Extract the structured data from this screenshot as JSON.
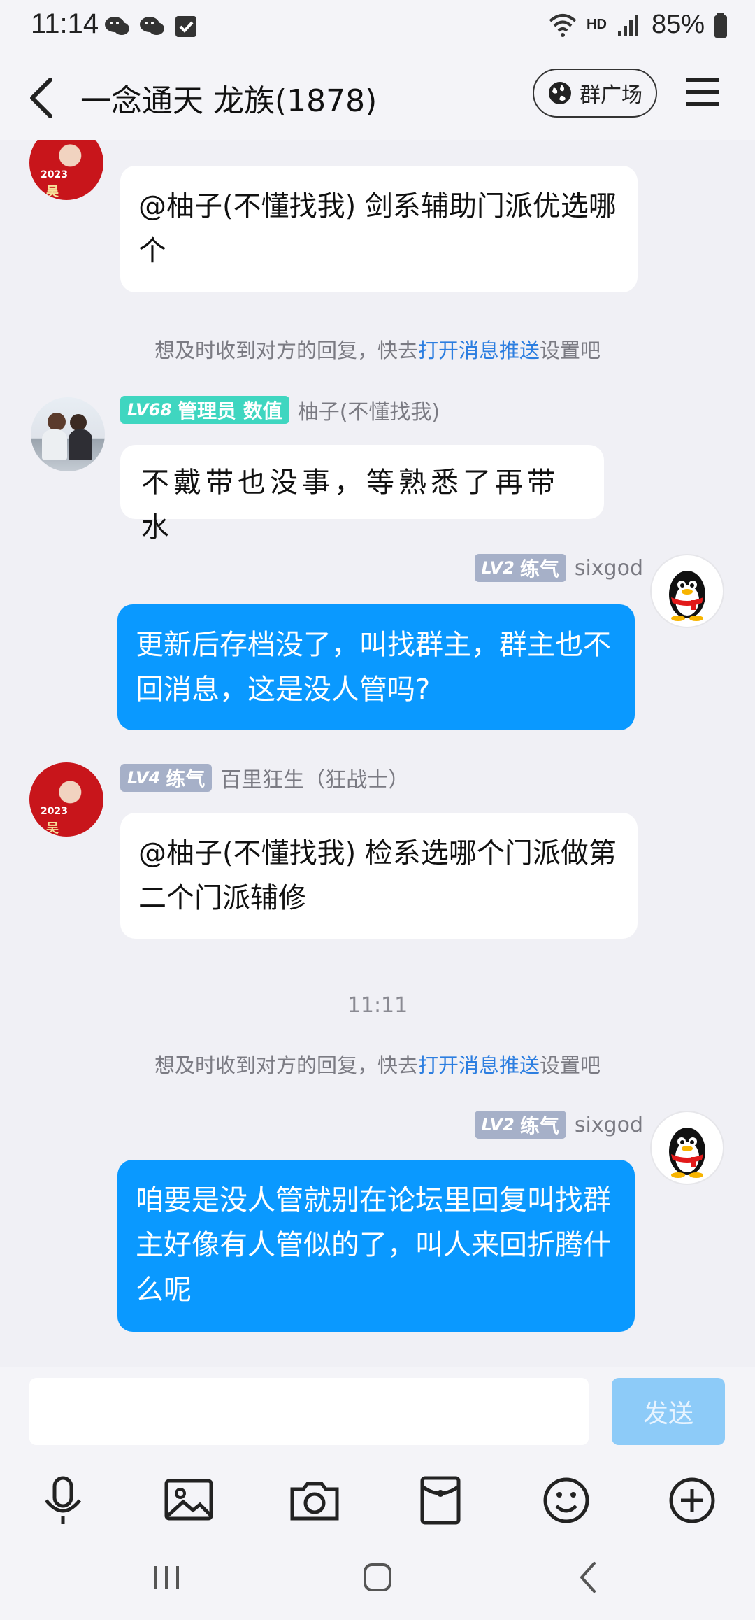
{
  "status_bar": {
    "time": "11:14",
    "battery": "85%",
    "network_label": "HD"
  },
  "header": {
    "title": "一念通天 龙族(1878)",
    "square_button": "群广场"
  },
  "messages": [
    {
      "side": "left",
      "avatar": "avatar-red-2023",
      "text": "@柚子(不懂找我) 剑系辅助门派优选哪个"
    },
    {
      "notice": {
        "prefix": "想及时收到对方的回复，快去",
        "link": "打开消息推送",
        "suffix": "设置吧"
      }
    },
    {
      "side": "left",
      "avatar": "avatar-couple",
      "badge_level": "LV68",
      "badge_title": "管理员 数值",
      "name": "柚子(不懂找我)",
      "text": "不戴带也没事，等熟悉了再带水"
    },
    {
      "side": "right",
      "avatar": "qq-penguin-icon",
      "badge_level": "LV2",
      "badge_title": "练气",
      "name": "sixgod",
      "text": "更新后存档没了，叫找群主，群主也不回消息，这是没人管吗?"
    },
    {
      "side": "left",
      "avatar": "avatar-red-2023",
      "badge_level": "LV4",
      "badge_title": "练气",
      "name": "百里狂生（狂战士）",
      "text": "@柚子(不懂找我) 检系选哪个门派做第二个门派辅修"
    },
    {
      "time": "11:11"
    },
    {
      "notice": {
        "prefix": "想及时收到对方的回复，快去",
        "link": "打开消息推送",
        "suffix": "设置吧"
      }
    },
    {
      "side": "right",
      "avatar": "qq-penguin-icon",
      "badge_level": "LV2",
      "badge_title": "练气",
      "name": "sixgod",
      "text": "咱要是没人管就别在论坛里回复叫找群主好像有人管似的了，叫人来回折腾什么呢"
    }
  ],
  "input_bar": {
    "placeholder": "",
    "send_label": "发送"
  },
  "avatar_text": "2023",
  "avatar_char": "吴",
  "toolbar_icons": [
    "microphone-icon",
    "image-icon",
    "camera-icon",
    "red-packet-icon",
    "emoji-icon",
    "plus-icon"
  ],
  "system_nav": [
    "recent-apps-icon",
    "home-icon",
    "back-icon"
  ],
  "colors": {
    "accent": "#0a99ff",
    "link": "#2c7ee0",
    "background": "#f0f0f5",
    "badge_teal": "#3fd6c0",
    "badge_gray": "#a6b0c8"
  }
}
